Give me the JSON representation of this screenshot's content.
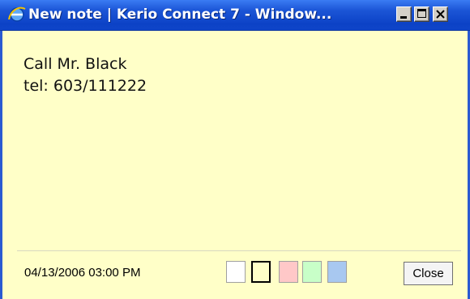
{
  "window": {
    "title": "New note | Kerio Connect 7 - Window..."
  },
  "note": {
    "text": "Call Mr. Black\ntel: 603/111222"
  },
  "footer": {
    "timestamp": "04/13/2006 03:00 PM",
    "color_swatches": [
      {
        "name": "white",
        "color": "#ffffff",
        "selected": false
      },
      {
        "name": "yellow",
        "color": "#ffffc8",
        "selected": true
      },
      {
        "name": "pink",
        "color": "#ffc8c8",
        "selected": false
      },
      {
        "name": "green",
        "color": "#c8ffc8",
        "selected": false
      },
      {
        "name": "blue",
        "color": "#a8c8f0",
        "selected": false
      }
    ],
    "close_label": "Close"
  },
  "icons": {
    "app": "ie-icon",
    "minimize": "minimize-icon",
    "maximize": "maximize-icon",
    "close": "close-icon"
  }
}
